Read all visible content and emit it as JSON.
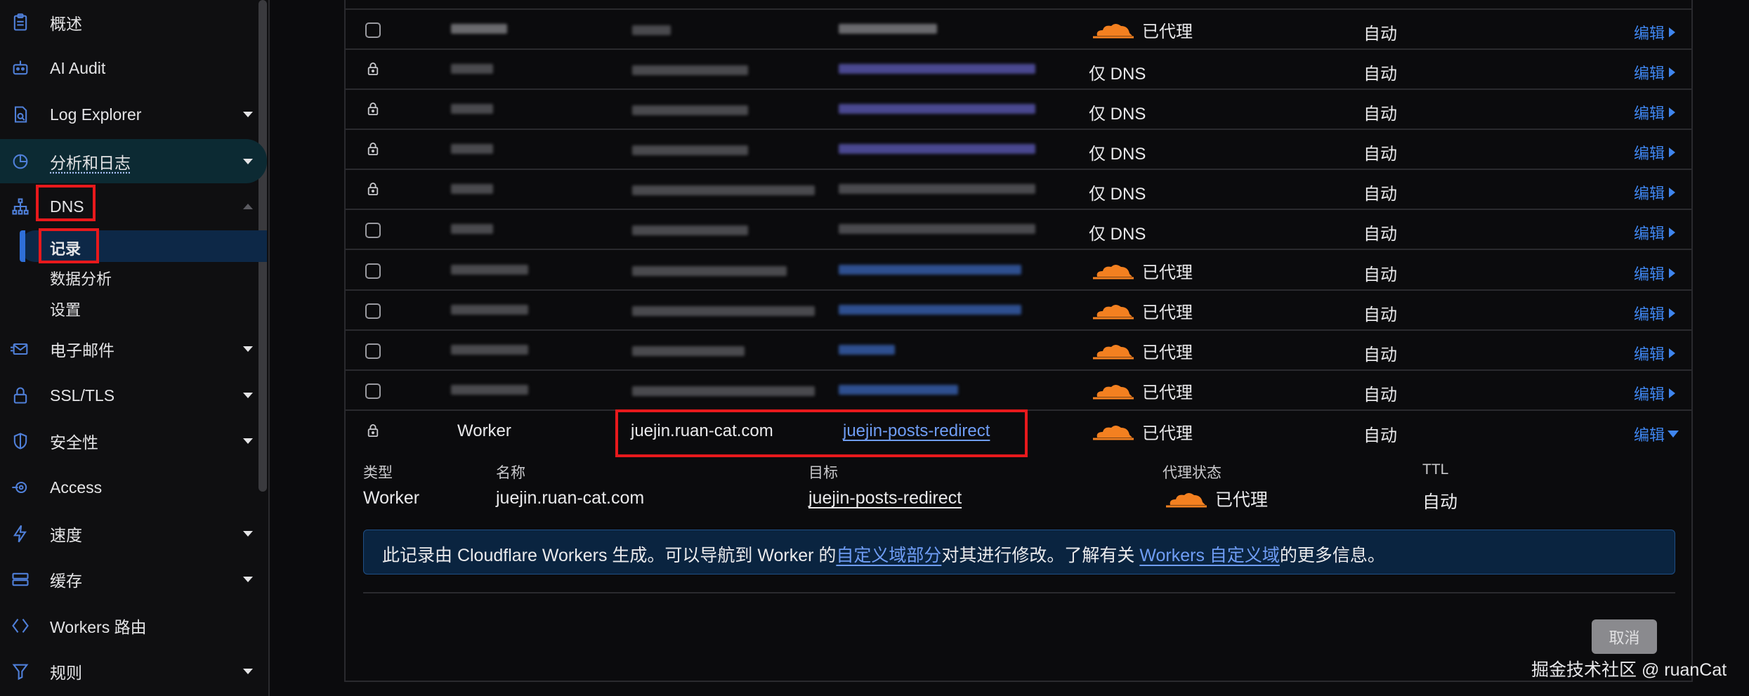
{
  "sidebar": {
    "items": [
      {
        "label": "概述",
        "icon": "clipboard-icon"
      },
      {
        "label": "AI Audit",
        "icon": "robot-icon"
      },
      {
        "label": "Log Explorer",
        "icon": "log-explorer-icon"
      },
      {
        "label": "分析和日志",
        "icon": "pie-chart-icon"
      },
      {
        "label": "DNS",
        "icon": "network-icon"
      },
      {
        "label": "电子邮件",
        "icon": "email-icon"
      },
      {
        "label": "SSL/TLS",
        "icon": "lock-icon"
      },
      {
        "label": "安全性",
        "icon": "shield-icon"
      },
      {
        "label": "Access",
        "icon": "access-icon"
      },
      {
        "label": "速度",
        "icon": "lightning-icon"
      },
      {
        "label": "缓存",
        "icon": "storage-icon"
      },
      {
        "label": "Workers 路由",
        "icon": "workers-icon"
      },
      {
        "label": "规则",
        "icon": "funnel-icon"
      }
    ],
    "dns_sub": [
      "记录",
      "数据分析",
      "设置"
    ]
  },
  "table": {
    "rows": [
      {
        "proxy": "已代理",
        "ttl": "自动",
        "edit": "编辑",
        "locked": false
      },
      {
        "proxy": "仅 DNS",
        "ttl": "自动",
        "edit": "编辑",
        "locked": true
      },
      {
        "proxy": "仅 DNS",
        "ttl": "自动",
        "edit": "编辑",
        "locked": true
      },
      {
        "proxy": "仅 DNS",
        "ttl": "自动",
        "edit": "编辑",
        "locked": true
      },
      {
        "proxy": "仅 DNS",
        "ttl": "自动",
        "edit": "编辑",
        "locked": true
      },
      {
        "proxy": "仅 DNS",
        "ttl": "自动",
        "edit": "编辑",
        "locked": false
      },
      {
        "proxy": "已代理",
        "ttl": "自动",
        "edit": "编辑",
        "locked": false
      },
      {
        "proxy": "已代理",
        "ttl": "自动",
        "edit": "编辑",
        "locked": false
      },
      {
        "proxy": "已代理",
        "ttl": "自动",
        "edit": "编辑",
        "locked": false
      },
      {
        "proxy": "已代理",
        "ttl": "自动",
        "edit": "编辑",
        "locked": false
      }
    ],
    "worker_row": {
      "type": "Worker",
      "name": "juejin.ruan-cat.com",
      "target": "juejin-posts-redirect",
      "proxy": "已代理",
      "ttl": "自动",
      "edit": "编辑"
    }
  },
  "detail": {
    "labels": {
      "type": "类型",
      "name": "名称",
      "target": "目标",
      "proxy": "代理状态",
      "ttl": "TTL"
    },
    "values": {
      "type": "Worker",
      "name": "juejin.ruan-cat.com",
      "target": "juejin-posts-redirect",
      "proxy": "已代理",
      "ttl": "自动"
    },
    "info": {
      "part1": "此记录由 Cloudflare Workers 生成。可以导航到 Worker 的",
      "link1": "自定义域部分",
      "part2": "对其进行修改。了解有关 ",
      "link2": "Workers 自定义域",
      "part3": "的更多信息。"
    },
    "cancel_label": "取消"
  },
  "watermark": "掘金技术社区 @ ruanCat",
  "colors": {
    "accent": "#3f86f0",
    "highlight": "#e8191c",
    "cloud": "#f38020"
  }
}
